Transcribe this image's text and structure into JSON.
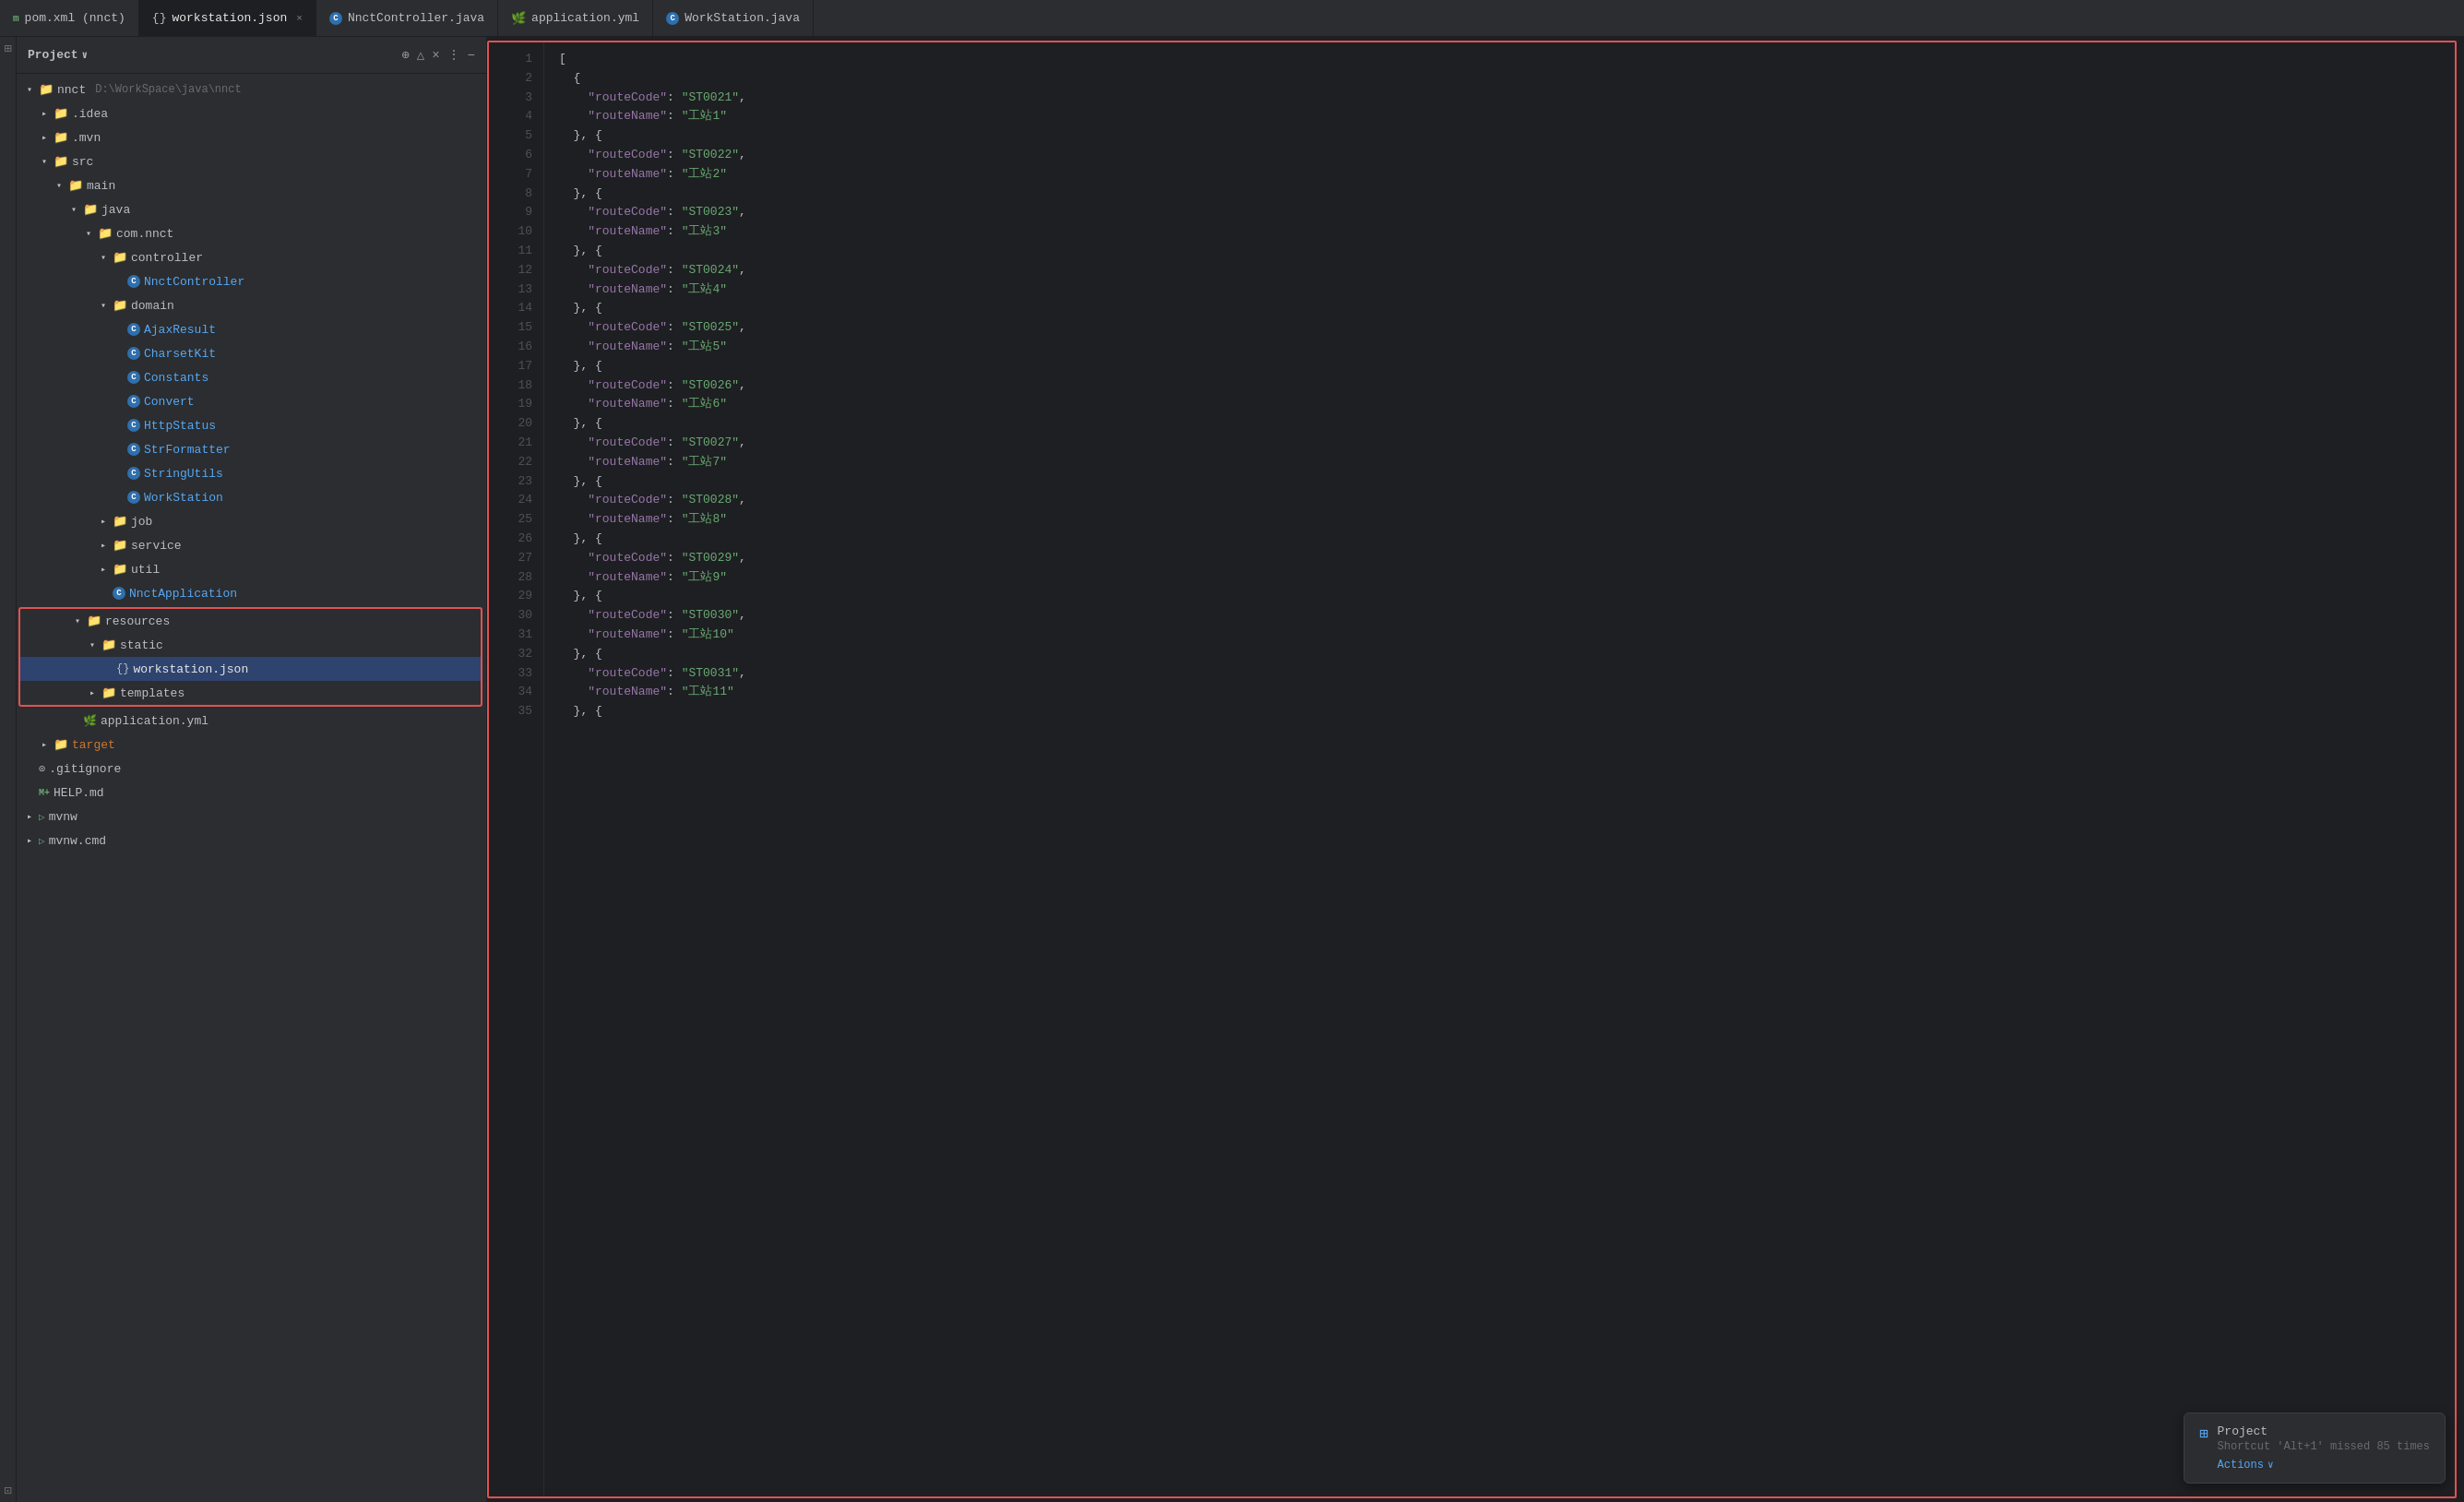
{
  "app": {
    "title": "Project"
  },
  "tabs": [
    {
      "id": "pom",
      "icon": "m",
      "label": "pom.xml (nnct)",
      "active": false,
      "closeable": false
    },
    {
      "id": "workstation-json",
      "icon": "brace",
      "label": "workstation.json",
      "active": true,
      "closeable": true
    },
    {
      "id": "nnct-controller",
      "icon": "circle-blue",
      "label": "NnctController.java",
      "active": false,
      "closeable": false
    },
    {
      "id": "application-yml",
      "icon": "yml",
      "label": "application.yml",
      "active": false,
      "closeable": false
    },
    {
      "id": "workstation-java",
      "icon": "circle-blue",
      "label": "WorkStation.java",
      "active": false,
      "closeable": false
    }
  ],
  "sidebar": {
    "title": "Project",
    "tree": [
      {
        "id": "nnct-root",
        "indent": 0,
        "type": "folder",
        "open": true,
        "name": "nnct",
        "hint": "D:\\WorkSpace\\java\\nnct"
      },
      {
        "id": "idea",
        "indent": 1,
        "type": "folder",
        "open": false,
        "name": ".idea"
      },
      {
        "id": "mvn",
        "indent": 1,
        "type": "folder",
        "open": false,
        "name": ".mvn"
      },
      {
        "id": "src",
        "indent": 1,
        "type": "folder",
        "open": true,
        "name": "src"
      },
      {
        "id": "main",
        "indent": 2,
        "type": "folder",
        "open": true,
        "name": "main"
      },
      {
        "id": "java",
        "indent": 3,
        "type": "folder",
        "open": true,
        "name": "java"
      },
      {
        "id": "com-nnct",
        "indent": 4,
        "type": "folder",
        "open": true,
        "name": "com.nnct"
      },
      {
        "id": "controller",
        "indent": 5,
        "type": "folder",
        "open": true,
        "name": "controller"
      },
      {
        "id": "NnctController",
        "indent": 6,
        "type": "java-class",
        "name": "NnctController"
      },
      {
        "id": "domain",
        "indent": 5,
        "type": "folder",
        "open": true,
        "name": "domain"
      },
      {
        "id": "AjaxResult",
        "indent": 6,
        "type": "java-class",
        "name": "AjaxResult"
      },
      {
        "id": "CharsetKit",
        "indent": 6,
        "type": "java-class",
        "name": "CharsetKit"
      },
      {
        "id": "Constants",
        "indent": 6,
        "type": "java-class",
        "name": "Constants"
      },
      {
        "id": "Convert",
        "indent": 6,
        "type": "java-class",
        "name": "Convert"
      },
      {
        "id": "HttpStatus",
        "indent": 6,
        "type": "java-class",
        "name": "HttpStatus"
      },
      {
        "id": "StrFormatter",
        "indent": 6,
        "type": "java-class",
        "name": "StrFormatter"
      },
      {
        "id": "StringUtils",
        "indent": 6,
        "type": "java-class",
        "name": "StringUtils"
      },
      {
        "id": "WorkStation",
        "indent": 6,
        "type": "java-class",
        "name": "WorkStation"
      },
      {
        "id": "job",
        "indent": 5,
        "type": "folder",
        "open": false,
        "name": "job"
      },
      {
        "id": "service",
        "indent": 5,
        "type": "folder",
        "open": false,
        "name": "service"
      },
      {
        "id": "util",
        "indent": 5,
        "type": "folder",
        "open": false,
        "name": "util"
      },
      {
        "id": "NnctApplication",
        "indent": 5,
        "type": "java-class",
        "name": "NnctApplication"
      },
      {
        "id": "resources",
        "indent": 3,
        "type": "folder",
        "open": true,
        "name": "resources",
        "outlined": true
      },
      {
        "id": "static",
        "indent": 4,
        "type": "folder",
        "open": true,
        "name": "static"
      },
      {
        "id": "workstation-json-file",
        "indent": 5,
        "type": "json-file",
        "name": "workstation.json",
        "selected": true
      },
      {
        "id": "templates",
        "indent": 4,
        "type": "folder",
        "open": false,
        "name": "templates"
      },
      {
        "id": "application-yml-file",
        "indent": 3,
        "type": "yml-file",
        "name": "application.yml"
      },
      {
        "id": "target",
        "indent": 1,
        "type": "folder",
        "open": false,
        "name": "target",
        "color": "orange"
      },
      {
        "id": "gitignore",
        "indent": 0,
        "type": "git-file",
        "name": ".gitignore"
      },
      {
        "id": "HELP-md",
        "indent": 0,
        "type": "md-file",
        "name": "HELP.md"
      },
      {
        "id": "mvnw",
        "indent": 0,
        "type": "mvn-file",
        "name": "mvnw"
      },
      {
        "id": "mvnw-cmd",
        "indent": 0,
        "type": "mvn-file",
        "name": "mvnw.cmd"
      }
    ]
  },
  "editor": {
    "lines": [
      {
        "num": 1,
        "content": "["
      },
      {
        "num": 2,
        "content": "  {"
      },
      {
        "num": 3,
        "content": "    \"routeCode\": \"ST0021\","
      },
      {
        "num": 4,
        "content": "    \"routeName\": \"工站1\""
      },
      {
        "num": 5,
        "content": "  }, {"
      },
      {
        "num": 6,
        "content": "    \"routeCode\": \"ST0022\","
      },
      {
        "num": 7,
        "content": "    \"routeName\": \"工站2\""
      },
      {
        "num": 8,
        "content": "  }, {"
      },
      {
        "num": 9,
        "content": "    \"routeCode\": \"ST0023\","
      },
      {
        "num": 10,
        "content": "    \"routeName\": \"工站3\""
      },
      {
        "num": 11,
        "content": "  }, {"
      },
      {
        "num": 12,
        "content": "    \"routeCode\": \"ST0024\","
      },
      {
        "num": 13,
        "content": "    \"routeName\": \"工站4\""
      },
      {
        "num": 14,
        "content": "  }, {"
      },
      {
        "num": 15,
        "content": "    \"routeCode\": \"ST0025\","
      },
      {
        "num": 16,
        "content": "    \"routeName\": \"工站5\""
      },
      {
        "num": 17,
        "content": "  }, {"
      },
      {
        "num": 18,
        "content": "    \"routeCode\": \"ST0026\","
      },
      {
        "num": 19,
        "content": "    \"routeName\": \"工站6\""
      },
      {
        "num": 20,
        "content": "  }, {"
      },
      {
        "num": 21,
        "content": "    \"routeCode\": \"ST0027\","
      },
      {
        "num": 22,
        "content": "    \"routeName\": \"工站7\""
      },
      {
        "num": 23,
        "content": "  }, {"
      },
      {
        "num": 24,
        "content": "    \"routeCode\": \"ST0028\","
      },
      {
        "num": 25,
        "content": "    \"routeName\": \"工站8\""
      },
      {
        "num": 26,
        "content": "  }, {"
      },
      {
        "num": 27,
        "content": "    \"routeCode\": \"ST0029\","
      },
      {
        "num": 28,
        "content": "    \"routeName\": \"工站9\""
      },
      {
        "num": 29,
        "content": "  }, {"
      },
      {
        "num": 30,
        "content": "    \"routeCode\": \"ST0030\","
      },
      {
        "num": 31,
        "content": "    \"routeName\": \"工站10\""
      },
      {
        "num": 32,
        "content": "  }, {"
      },
      {
        "num": 33,
        "content": "    \"routeCode\": \"ST0031\","
      },
      {
        "num": 34,
        "content": "    \"routeName\": \"工站11\""
      },
      {
        "num": 35,
        "content": "  }, {"
      }
    ]
  },
  "notification": {
    "title": "Project",
    "message": "Shortcut 'Alt+1' missed 85 times",
    "action_label": "Actions"
  }
}
